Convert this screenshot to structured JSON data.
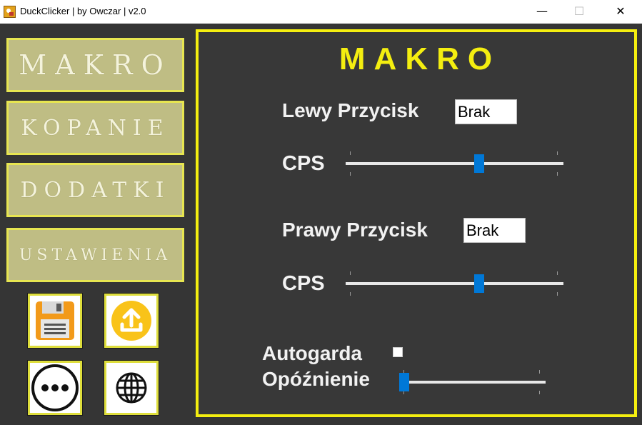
{
  "window": {
    "title": "DuckClicker | by Owczar | v2.0",
    "min_glyph": "—",
    "max_glyph": "☐",
    "close_glyph": "✕"
  },
  "sidebar": {
    "nav": [
      {
        "label": "MAKRO"
      },
      {
        "label": "KOPANIE"
      },
      {
        "label": "DODATKI"
      },
      {
        "label": "USTAWIENIA"
      }
    ],
    "icons": [
      "floppy-save-icon",
      "upload-icon",
      "more-icon",
      "globe-icon"
    ]
  },
  "main": {
    "title": "MAKRO",
    "left_button": {
      "label": "Lewy Przycisk",
      "value": "Brak",
      "cps_label": "CPS",
      "cps_level": 0.62
    },
    "right_button": {
      "label": "Prawy Przycisk",
      "value": "Brak",
      "cps_label": "CPS",
      "cps_level": 0.62
    },
    "autogarda": {
      "label": "Autogarda",
      "checked": false
    },
    "delay": {
      "label": "Opóźnienie",
      "level": 0.0
    }
  },
  "colors": {
    "accent": "#f4ee10",
    "panel_bg": "#383838",
    "nav_button": "#bfbd84",
    "slider_thumb": "#0078d7",
    "upload_circle": "#f9c319"
  }
}
